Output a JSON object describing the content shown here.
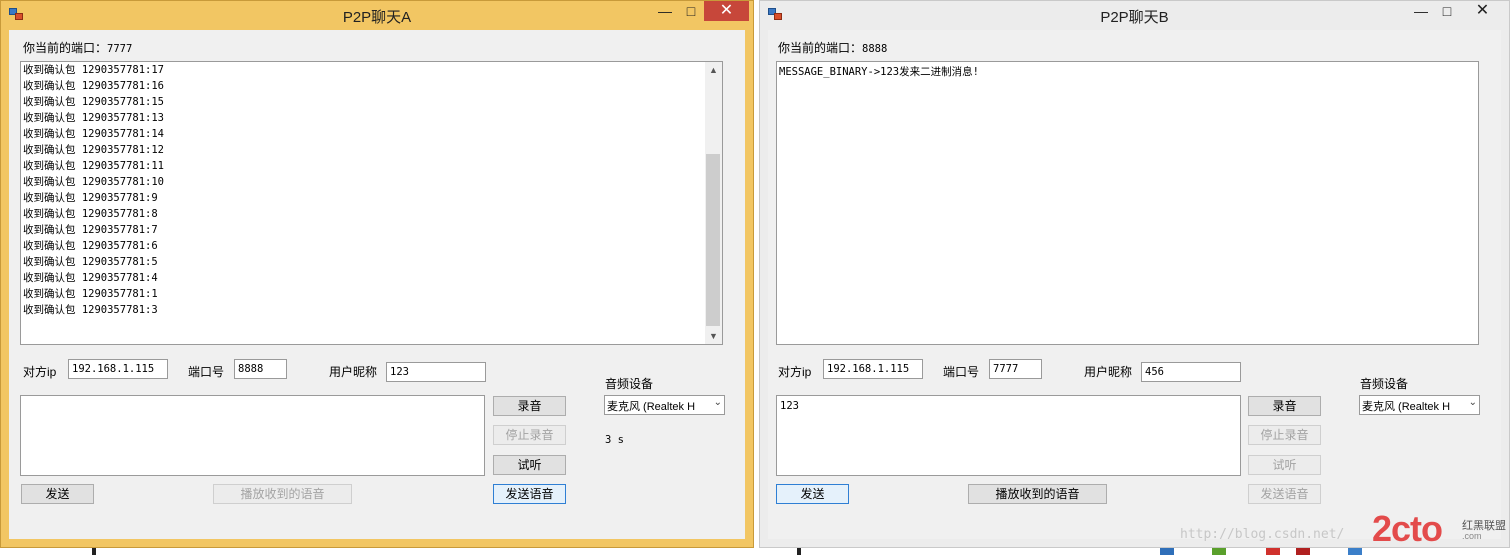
{
  "colors": {
    "window_a_frame": "#f2c663",
    "window_b_frame": "#ececec",
    "close_button_active": "#c7473a",
    "client_background": "#f0f0f0"
  },
  "icons": {
    "app": "app-icon",
    "minimize": "minimize-icon",
    "maximize": "maximize-icon",
    "close": "close-icon",
    "scroll_up": "chevron-up-icon",
    "scroll_down": "chevron-down-icon",
    "dropdown": "chevron-down-icon"
  },
  "window_a": {
    "title": "P2P聊天A",
    "current_port_label": "你当前的端口：",
    "current_port": "7777",
    "log_lines": [
      "收到确认包 1290357781:17",
      "收到确认包 1290357781:16",
      "收到确认包 1290357781:15",
      "收到确认包 1290357781:13",
      "收到确认包 1290357781:14",
      "收到确认包 1290357781:12",
      "收到确认包 1290357781:11",
      "收到确认包 1290357781:10",
      "收到确认包 1290357781:9",
      "收到确认包 1290357781:8",
      "收到确认包 1290357781:7",
      "收到确认包 1290357781:6",
      "收到确认包 1290357781:5",
      "收到确认包 1290357781:4",
      "收到确认包 1290357781:1",
      "收到确认包 1290357781:3"
    ],
    "peer_ip_label": "对方ip",
    "peer_ip": "192.168.1.115",
    "port_label": "端口号",
    "port": "8888",
    "nickname_label": "用户昵称",
    "nickname": "123",
    "audio_device_label": "音频设备",
    "audio_device": "麦克风 (Realtek H",
    "message_text": "",
    "record_time": "3 s",
    "buttons": {
      "record": "录音",
      "stop_record": "停止录音",
      "listen": "试听",
      "send_voice": "发送语音",
      "send": "发送",
      "play_received": "播放收到的语音"
    }
  },
  "window_b": {
    "title": "P2P聊天B",
    "current_port_label": "你当前的端口：",
    "current_port": "8888",
    "log_lines": [
      "MESSAGE_BINARY->123发来二进制消息!"
    ],
    "peer_ip_label": "对方ip",
    "peer_ip": "192.168.1.115",
    "port_label": "端口号",
    "port": "7777",
    "nickname_label": "用户昵称",
    "nickname": "456",
    "audio_device_label": "音频设备",
    "audio_device": "麦克风 (Realtek H",
    "message_text": "123",
    "buttons": {
      "record": "录音",
      "stop_record": "停止录音",
      "listen": "试听",
      "send_voice": "发送语音",
      "send": "发送",
      "play_received": "播放收到的语音"
    }
  },
  "watermark": {
    "url": "http://blog.csdn.net/",
    "logo": "2cto",
    "logo_sub": "红黑联盟",
    "logo_sub2": ".com"
  }
}
